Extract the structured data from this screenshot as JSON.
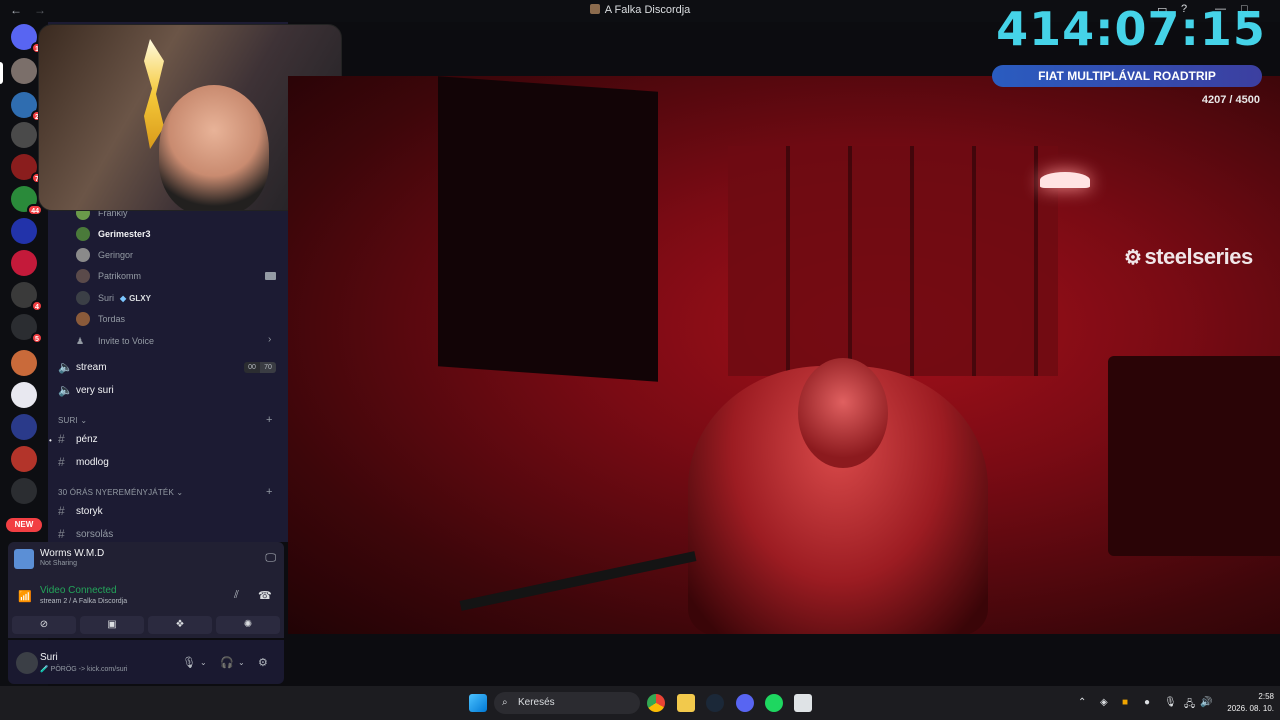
{
  "window": {
    "title": "A Falka Discordja"
  },
  "rail": {
    "new_badge": "NEW",
    "servers": [
      {
        "icon": "discord-home-icon",
        "badge": "1",
        "color": "#5865f2"
      },
      {
        "icon": "server-icon-1",
        "badge": "",
        "color": "#7b6f6a"
      },
      {
        "icon": "server-icon-2",
        "badge": "2",
        "color": "#2f6db0"
      },
      {
        "icon": "server-icon-3",
        "badge": "",
        "color": "#4a4a4a"
      },
      {
        "icon": "server-icon-4",
        "badge": "7",
        "color": "#8a1d1d"
      },
      {
        "icon": "server-icon-5",
        "badge": "44",
        "color": "#2a8a3a"
      },
      {
        "icon": "server-icon-6",
        "badge": "",
        "color": "#2233aa"
      },
      {
        "icon": "server-icon-7",
        "badge": "",
        "color": "#c41a3a"
      },
      {
        "icon": "server-icon-8",
        "badge": "4",
        "color": "#3a3a3a"
      },
      {
        "icon": "server-folder-icon",
        "badge": "5",
        "color": "#2b2d31"
      },
      {
        "icon": "server-icon-9",
        "badge": "",
        "color": "#c96a3a"
      },
      {
        "icon": "server-icon-10",
        "badge": "",
        "color": "#e8e8f0"
      },
      {
        "icon": "server-icon-11",
        "badge": "",
        "color": "#2a3a8a"
      },
      {
        "icon": "server-icon-12",
        "badge": "",
        "color": "#b3342a"
      },
      {
        "icon": "server-icon-13",
        "badge": "",
        "color": "#2b2d31"
      }
    ]
  },
  "voice_members": [
    {
      "name": "Frankly",
      "active": false,
      "color": "#6a9a4a"
    },
    {
      "name": "Gerimester3",
      "active": true,
      "color": "#4a7a3a"
    },
    {
      "name": "Geringor",
      "active": false,
      "color": "#8a8a8a"
    },
    {
      "name": "Patrikomm",
      "active": false,
      "color": "#5a4a4a",
      "camera": true
    },
    {
      "name": "Suri",
      "active": false,
      "color": "#3b3f46",
      "tag": "GLXY"
    },
    {
      "name": "Tordas",
      "active": false,
      "color": "#8a5a3a"
    }
  ],
  "invite_label": "Invite to Voice",
  "voice_channels": [
    {
      "name": "stream",
      "count_a": "00",
      "count_b": "70"
    },
    {
      "name": "very suri"
    }
  ],
  "categories": [
    {
      "name": "suri",
      "channels": [
        "pénz",
        "modlog"
      ]
    },
    {
      "name": "30 ÓRÁS NYEREMÉNYJÁTÉK",
      "channels": [
        "storyk",
        "sorsolás"
      ]
    }
  ],
  "activity": {
    "name": "Worms W.M.D",
    "status": "Not Sharing"
  },
  "voice_status": {
    "title": "Video Connected",
    "subtitle": "stream 2 / A Falka Discordja"
  },
  "user": {
    "name": "Suri",
    "status": "🧪 PÖRÖG -> kick.com/suri"
  },
  "overlay": {
    "timer": "414:07:15",
    "banner": "FIAT MULTIPLÁVAL ROADTRIP",
    "counter": "4207 / 4500",
    "sponsor": "steelseries"
  },
  "taskbar": {
    "search_placeholder": "Keresés",
    "time": "2:58",
    "date": "2026. 08. 10."
  }
}
